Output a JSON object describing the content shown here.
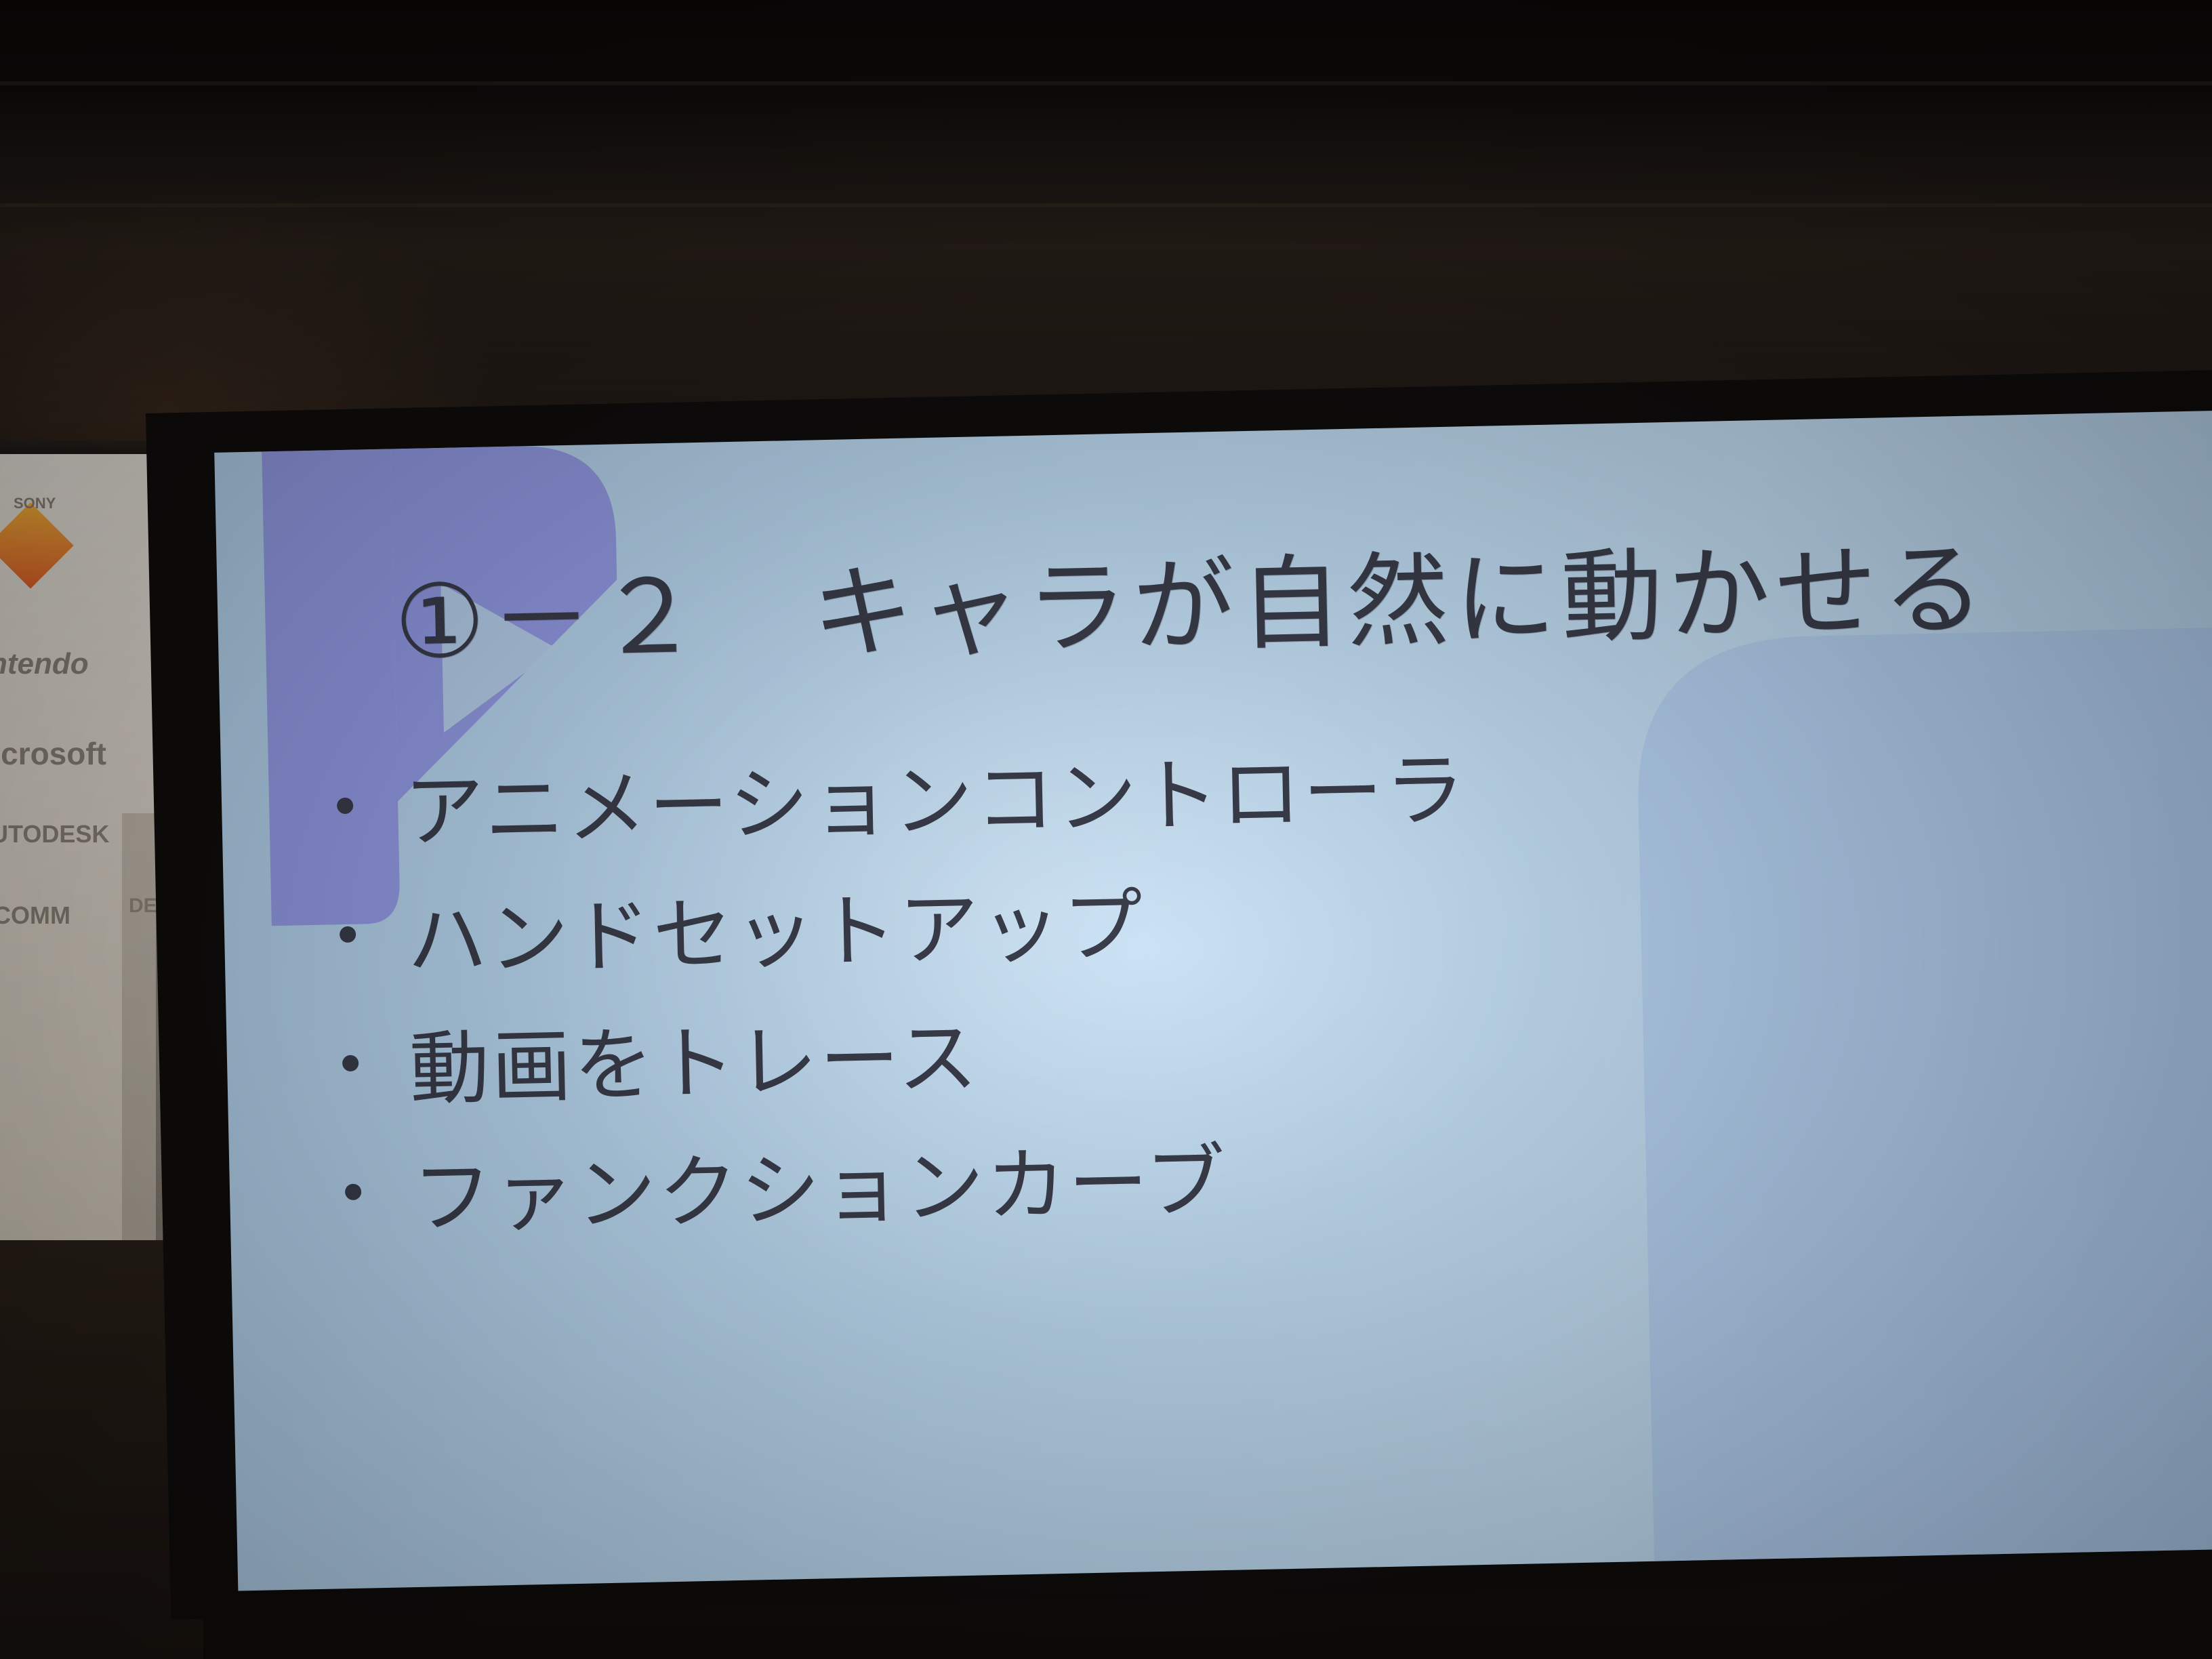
{
  "slide": {
    "title": "①－２　キャラが自然に動かせる",
    "bullets": [
      "アニメーションコントローラ",
      "ハンドセットアップ",
      "動画をトレース",
      "ファンクションカーブ"
    ]
  },
  "banner": {
    "logos": [
      "SONY",
      "Nintendo",
      "Microsoft",
      "AUTODESK",
      "COMM",
      "DESK"
    ]
  },
  "colors": {
    "slide_background": "#bddbf2",
    "slide_text": "#3a3d4a",
    "decor_shape": "#8f93e6",
    "room": "#1a1512"
  }
}
